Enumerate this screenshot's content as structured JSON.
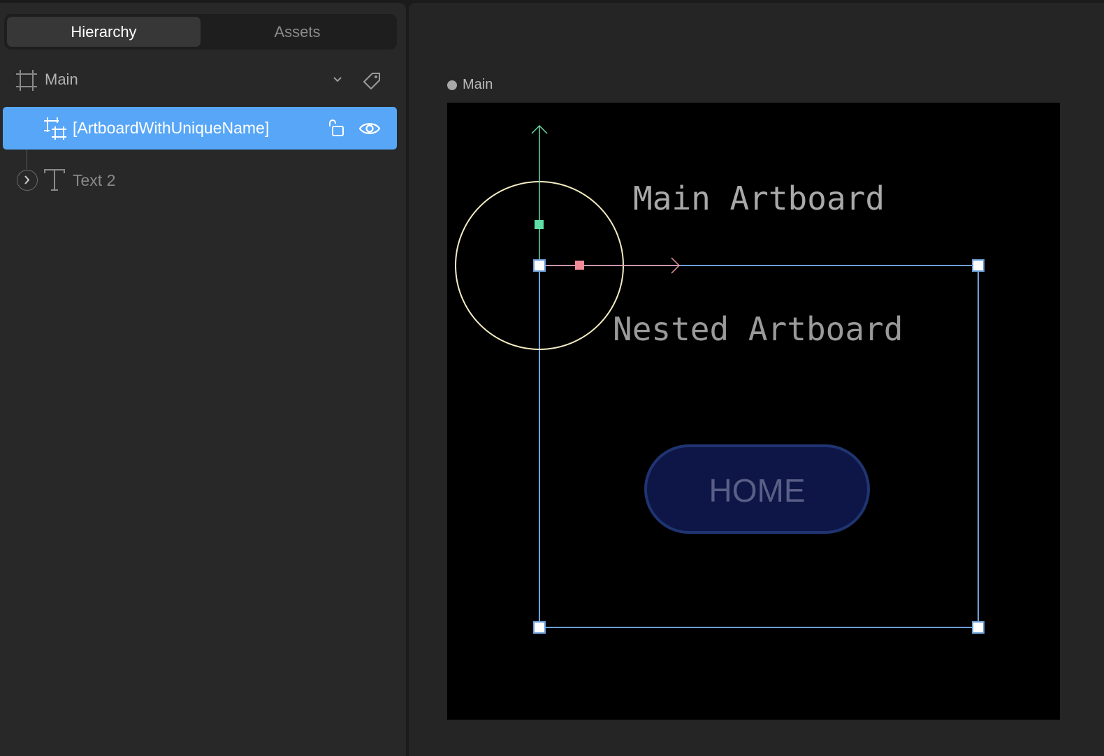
{
  "tabs": {
    "hierarchy": "Hierarchy",
    "assets": "Assets"
  },
  "hierarchy": {
    "root": {
      "label": "Main",
      "icon": "frame-icon"
    },
    "selected": {
      "label": "[ArtboardWithUniqueName]",
      "icon": "nested-artboard-icon"
    },
    "child": {
      "label": "Text 2",
      "icon": "text-icon"
    }
  },
  "canvas": {
    "artboard_name": "Main",
    "main_text": "Main Artboard",
    "nested_text": "Nested Artboard",
    "button_label": "HOME"
  },
  "colors": {
    "selection": "#57a6f7",
    "y_axis": "#6fd9a4",
    "x_axis": "#e8929a",
    "bounding_box": "#6c9fd8",
    "circle": "#f3ecc3",
    "button_fill": "#0e1647",
    "button_stroke": "#1f3471"
  }
}
